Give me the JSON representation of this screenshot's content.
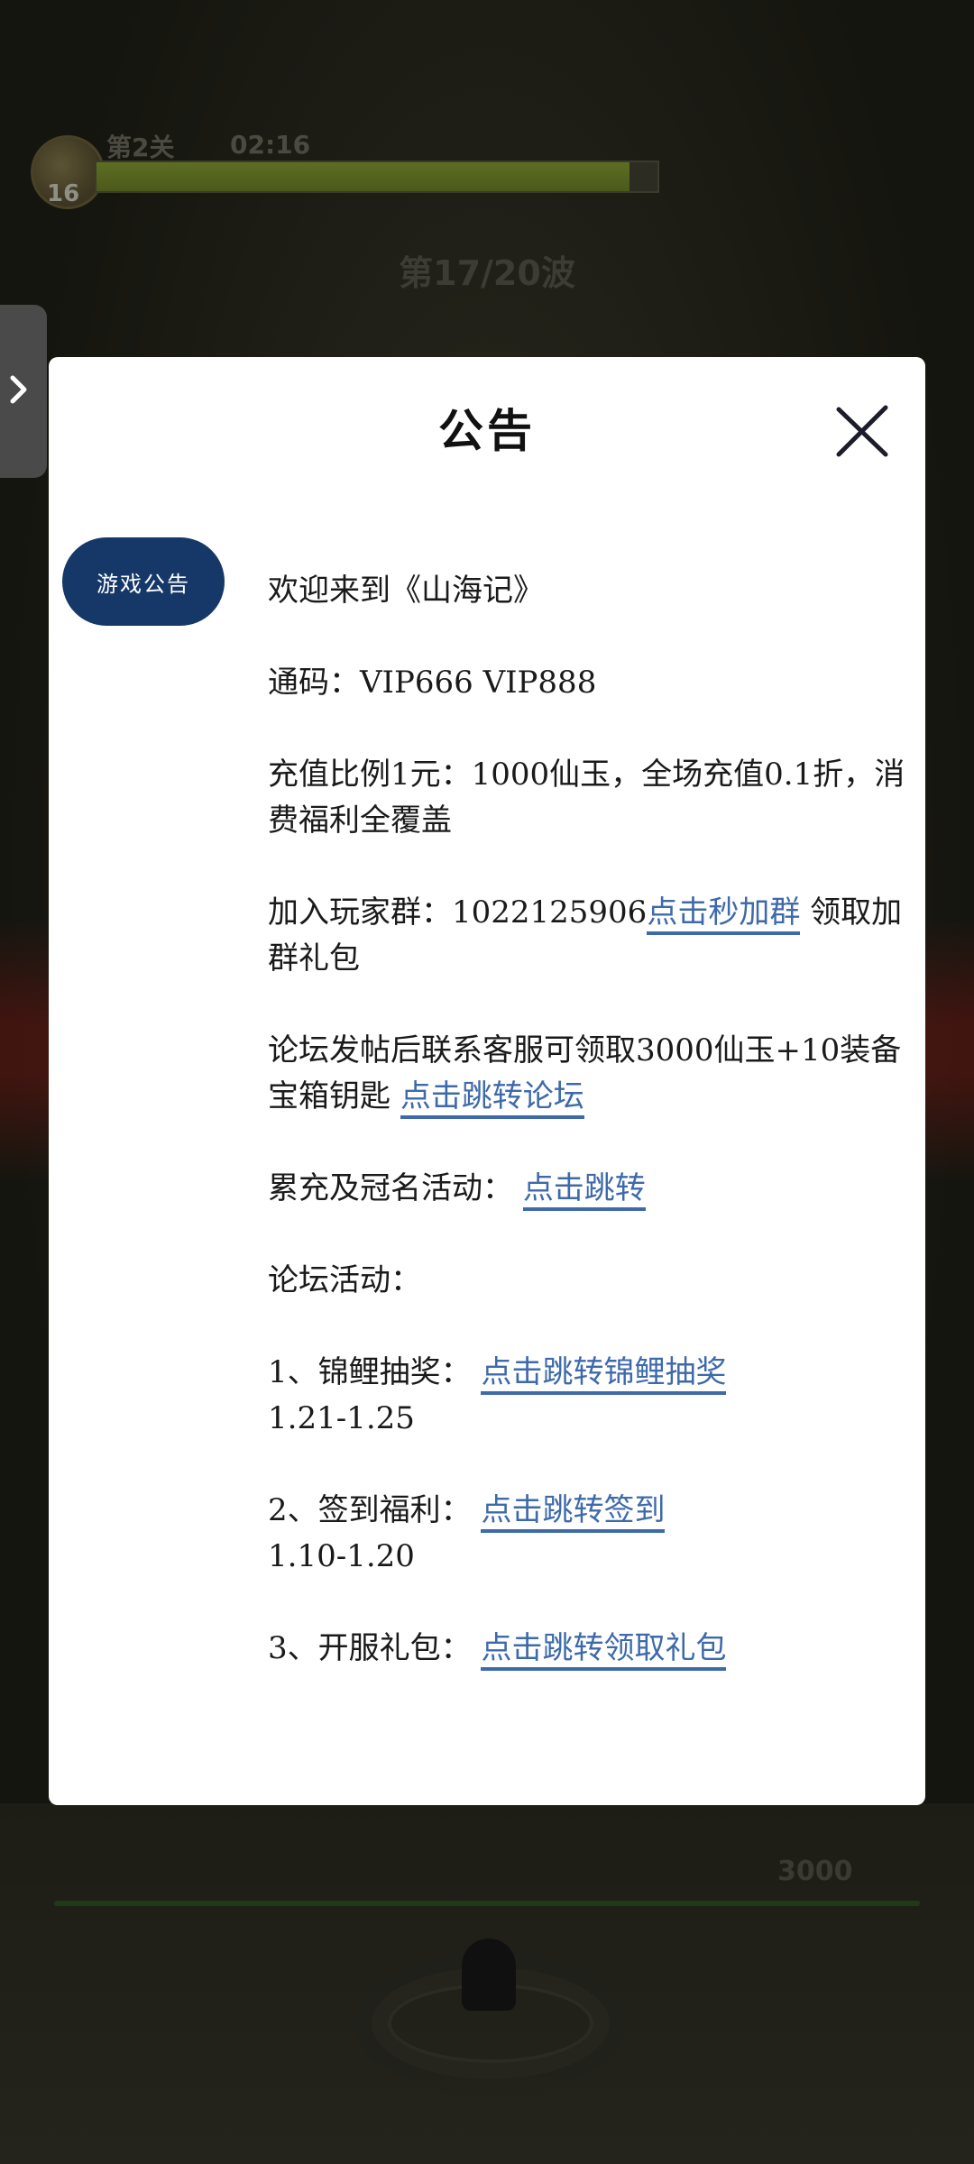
{
  "game": {
    "level": "16",
    "stage": "第2关",
    "timer": "02:16",
    "wave": "第17/20波",
    "score": "3000",
    "progress": 0.95
  },
  "dialog": {
    "title": "公告",
    "close_icon": "close-x-icon",
    "tab_label": "游戏公告",
    "colors": {
      "tab_bg": "#163869",
      "link": "#3e6aaa",
      "text": "#1a1a1a"
    },
    "announcement": {
      "welcome": "欢迎来到《山海记》",
      "codes": "通码：VIP666 VIP888",
      "recharge_ratio": "充值比例1元：1000仙玉，全场充值0.1折，消费福利全覆盖",
      "group_prefix": "加入玩家群：1022125906",
      "group_link": "点击秒加群",
      "group_suffix": " 领取加群礼包",
      "forum_reward_prefix": "论坛发帖后联系客服可领取3000仙玉+10装备宝箱钥匙 ",
      "forum_link": "点击跳转论坛",
      "cumulative_prefix": "累充及冠名活动： ",
      "cumulative_link": "点击跳转",
      "forum_activities": "论坛活动：",
      "activity1_prefix": "1、锦鲤抽奖： ",
      "activity1_link": "点击跳转锦鲤抽奖",
      "activity1_dates": "1.21-1.25",
      "activity2_prefix": "2、签到福利： ",
      "activity2_link": "点击跳转签到",
      "activity2_dates": "1.10-1.20",
      "activity3_prefix": "3、开服礼包： ",
      "activity3_link": "点击跳转领取礼包"
    }
  },
  "side_tab_icon": "chevron-right-icon"
}
